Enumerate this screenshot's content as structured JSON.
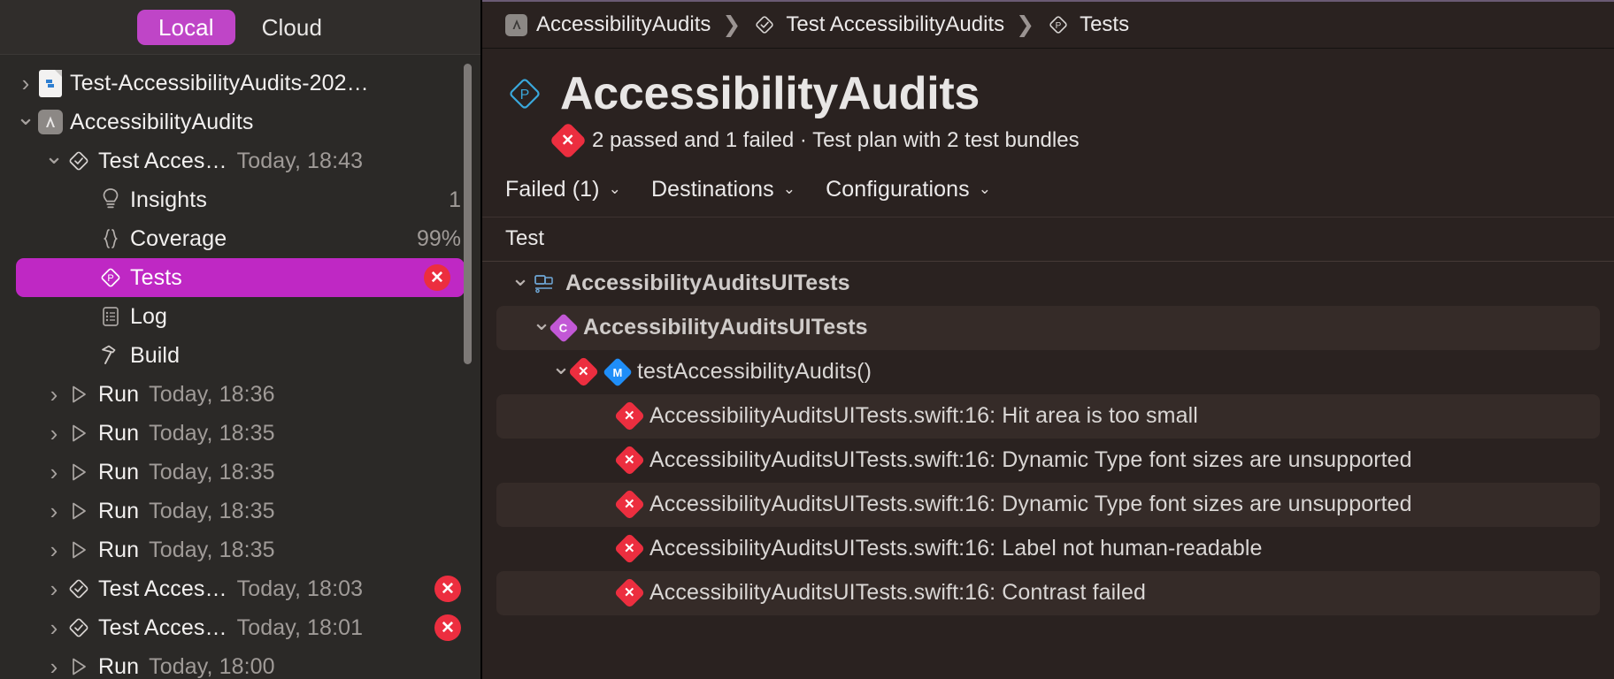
{
  "sidebar": {
    "segmented": {
      "options": [
        "Local",
        "Cloud"
      ],
      "selected": "Local",
      "local_label": "Local",
      "cloud_label": "Cloud"
    },
    "tree": [
      {
        "label": "Test-AccessibilityAudits-202…",
        "sub": "",
        "trail": "",
        "icon": "document-icon",
        "chevron": "›",
        "indent": 0,
        "selected": false
      },
      {
        "label": "AccessibilityAudits",
        "sub": "",
        "trail": "",
        "icon": "app-icon",
        "chevron": "⌄",
        "indent": 0,
        "selected": false
      },
      {
        "label": "Test Acces…",
        "sub": "Today, 18:43",
        "trail": "",
        "icon": "test-diamond-icon",
        "chevron": "⌄",
        "indent": 1,
        "selected": false
      },
      {
        "label": "Insights",
        "sub": "",
        "trail": "1",
        "icon": "lightbulb-icon",
        "chevron": "",
        "indent": 2,
        "selected": false
      },
      {
        "label": "Coverage",
        "sub": "",
        "trail": "99%",
        "icon": "braces-icon",
        "chevron": "",
        "indent": 2,
        "selected": false
      },
      {
        "label": "Tests",
        "sub": "",
        "trail": "error-badge",
        "icon": "tests-plan-icon",
        "chevron": "",
        "indent": 2,
        "selected": true
      },
      {
        "label": "Log",
        "sub": "",
        "trail": "",
        "icon": "log-icon",
        "chevron": "",
        "indent": 2,
        "selected": false
      },
      {
        "label": "Build",
        "sub": "",
        "trail": "",
        "icon": "hammer-icon",
        "chevron": "",
        "indent": 2,
        "selected": false
      },
      {
        "label": "Run",
        "sub": "Today, 18:36",
        "trail": "",
        "icon": "run-triangle-icon",
        "chevron": "›",
        "indent": 1,
        "selected": false
      },
      {
        "label": "Run",
        "sub": "Today, 18:35",
        "trail": "",
        "icon": "run-triangle-icon",
        "chevron": "›",
        "indent": 1,
        "selected": false
      },
      {
        "label": "Run",
        "sub": "Today, 18:35",
        "trail": "",
        "icon": "run-triangle-icon",
        "chevron": "›",
        "indent": 1,
        "selected": false
      },
      {
        "label": "Run",
        "sub": "Today, 18:35",
        "trail": "",
        "icon": "run-triangle-icon",
        "chevron": "›",
        "indent": 1,
        "selected": false
      },
      {
        "label": "Run",
        "sub": "Today, 18:35",
        "trail": "",
        "icon": "run-triangle-icon",
        "chevron": "›",
        "indent": 1,
        "selected": false
      },
      {
        "label": "Test Acces…",
        "sub": "Today, 18:03",
        "trail": "error-badge",
        "icon": "test-diamond-icon",
        "chevron": "›",
        "indent": 1,
        "selected": false
      },
      {
        "label": "Test Acces…",
        "sub": "Today, 18:01",
        "trail": "error-badge",
        "icon": "test-diamond-icon",
        "chevron": "›",
        "indent": 1,
        "selected": false
      },
      {
        "label": "Run",
        "sub": "Today, 18:00",
        "trail": "",
        "icon": "run-triangle-icon",
        "chevron": "›",
        "indent": 1,
        "selected": false
      }
    ]
  },
  "main": {
    "breadcrumb": [
      {
        "label": "AccessibilityAudits",
        "icon": "app-icon"
      },
      {
        "label": "Test AccessibilityAudits",
        "icon": "test-diamond-icon"
      },
      {
        "label": "Tests",
        "icon": "tests-plan-icon"
      }
    ],
    "separator": "❯",
    "hero": {
      "title": "AccessibilityAudits",
      "icon": "tests-plan-icon",
      "status_text": "2 passed and 1 failed · Test plan with 2 test bundles",
      "status_icon": "error-icon",
      "passed_count": 2,
      "failed_count": 1,
      "bundle_count": 2
    },
    "filters": [
      {
        "label": "Failed (1)",
        "caret": "⌄"
      },
      {
        "label": "Destinations",
        "caret": "⌄"
      },
      {
        "label": "Configurations",
        "caret": "⌄"
      }
    ],
    "column_header": "Test",
    "rows": [
      {
        "label": "AccessibilityAuditsUITests",
        "indent": 0,
        "chevron": "⌄",
        "icon": "bundle-icon",
        "bold": true,
        "alt": false
      },
      {
        "label": "AccessibilityAuditsUITests",
        "indent": 1,
        "chevron": "⌄",
        "icon": "class-icon",
        "bold": true,
        "alt": true
      },
      {
        "label": "testAccessibilityAudits()",
        "indent": 2,
        "chevron": "⌄",
        "icon": "method-icon",
        "bold": false,
        "alt": false
      },
      {
        "label": "AccessibilityAuditsUITests.swift:16: Hit area is too small",
        "indent": 3,
        "chevron": "",
        "icon": "error-icon",
        "bold": false,
        "alt": true
      },
      {
        "label": "AccessibilityAuditsUITests.swift:16: Dynamic Type font sizes are unsupported",
        "indent": 3,
        "chevron": "",
        "icon": "error-icon",
        "bold": false,
        "alt": false
      },
      {
        "label": "AccessibilityAuditsUITests.swift:16: Dynamic Type font sizes are unsupported",
        "indent": 3,
        "chevron": "",
        "icon": "error-icon",
        "bold": false,
        "alt": true
      },
      {
        "label": "AccessibilityAuditsUITests.swift:16: Label not human-readable",
        "indent": 3,
        "chevron": "",
        "icon": "error-icon",
        "bold": false,
        "alt": false
      },
      {
        "label": "AccessibilityAuditsUITests.swift:16: Contrast failed",
        "indent": 3,
        "chevron": "",
        "icon": "error-icon",
        "bold": false,
        "alt": true
      }
    ]
  },
  "colors": {
    "accent": "#bf28c4",
    "error": "#ec2e3f",
    "test_plan_blue": "#3aa8dc",
    "method_blue": "#1f8ef8",
    "class_purple": "#c258d6"
  }
}
